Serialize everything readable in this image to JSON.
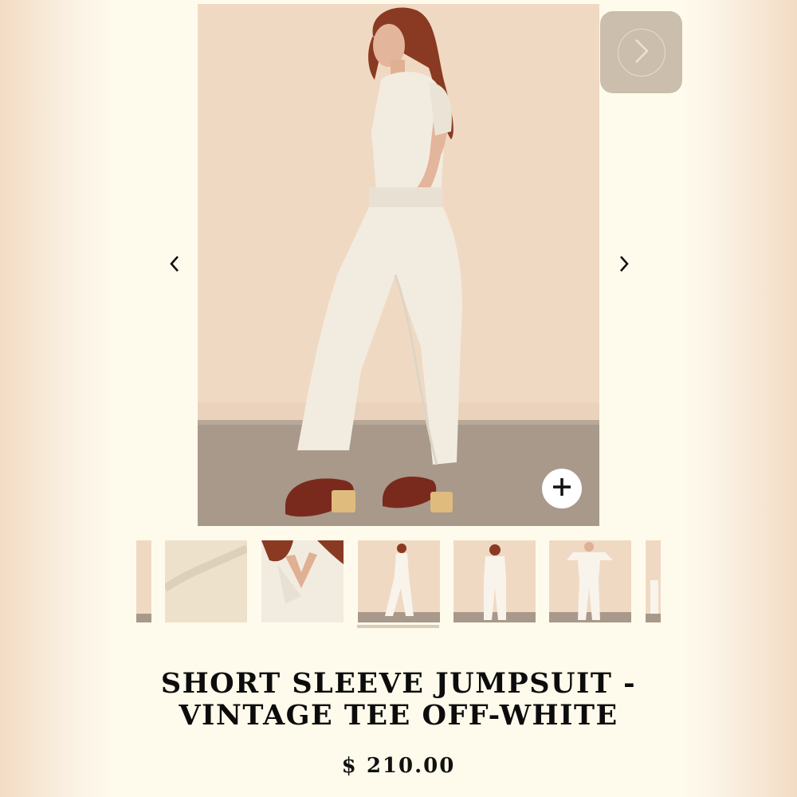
{
  "product": {
    "title": "SHORT SLEEVE JUMPSUIT - VINTAGE TEE OFF-WHITE",
    "price": "$ 210.00"
  },
  "gallery": {
    "main_image": "model-jumpsuit-side-view",
    "thumbnails": [
      "partial-thumbnail-left",
      "fabric-detail",
      "collar-detail",
      "model-side-view",
      "model-back-view",
      "model-front-view",
      "partial-thumbnail-right"
    ],
    "active_thumbnail_index": 3
  },
  "icons": {
    "prev": "chevron-left-icon",
    "next": "chevron-right-icon",
    "zoom": "plus-icon",
    "overlay_next": "chevron-right-icon"
  },
  "colors": {
    "page_bg": "#fffbec",
    "backdrop": "#f0d9c3",
    "floor": "#a8998a",
    "garment": "#f2ece0",
    "clog": "#7a2a1c",
    "text": "#0c0c0c"
  }
}
